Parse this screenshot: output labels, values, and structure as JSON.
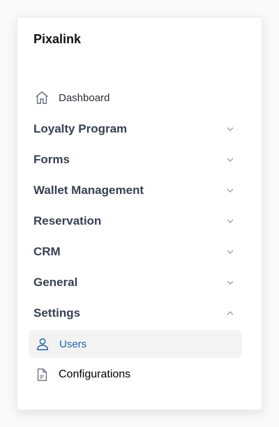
{
  "brand": {
    "name": "Pixalink"
  },
  "nav": {
    "dashboard": {
      "label": "Dashboard",
      "icon": "home-icon"
    },
    "groups": [
      {
        "label": "Loyalty Program",
        "expanded": false
      },
      {
        "label": "Forms",
        "expanded": false
      },
      {
        "label": "Wallet Management",
        "expanded": false
      },
      {
        "label": "Reservation",
        "expanded": false
      },
      {
        "label": "CRM",
        "expanded": false
      },
      {
        "label": "General",
        "expanded": false
      },
      {
        "label": "Settings",
        "expanded": true
      }
    ],
    "settings_items": [
      {
        "label": "Users",
        "icon": "user-icon",
        "active": true
      },
      {
        "label": "Configurations",
        "icon": "document-icon",
        "active": false
      }
    ]
  },
  "colors": {
    "active_text": "#2563a8",
    "active_bg": "#f3f3f4",
    "group_text": "#374151"
  }
}
